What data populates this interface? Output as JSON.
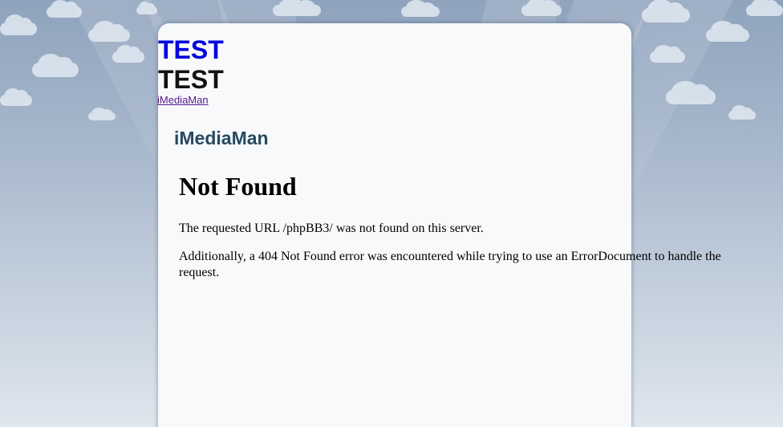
{
  "header": {
    "title_blue": "TEST",
    "title_black": "TEST",
    "site_link": "iMediaMan"
  },
  "site": {
    "name": "iMediaMan"
  },
  "error": {
    "title": "Not Found",
    "message": "The requested URL /phpBB3/ was not found on this server.",
    "additional": "Additionally, a 404 Not Found error was encountered while trying to use an ErrorDocument to handle the request."
  },
  "colors": {
    "sky_top": "#8fa3bd",
    "sky_bottom": "#dfe6ee",
    "card_background": "#f8f9fb",
    "title_blue": "#0000dd",
    "site_name": "#264a60",
    "visited_link": "#551a8b"
  }
}
